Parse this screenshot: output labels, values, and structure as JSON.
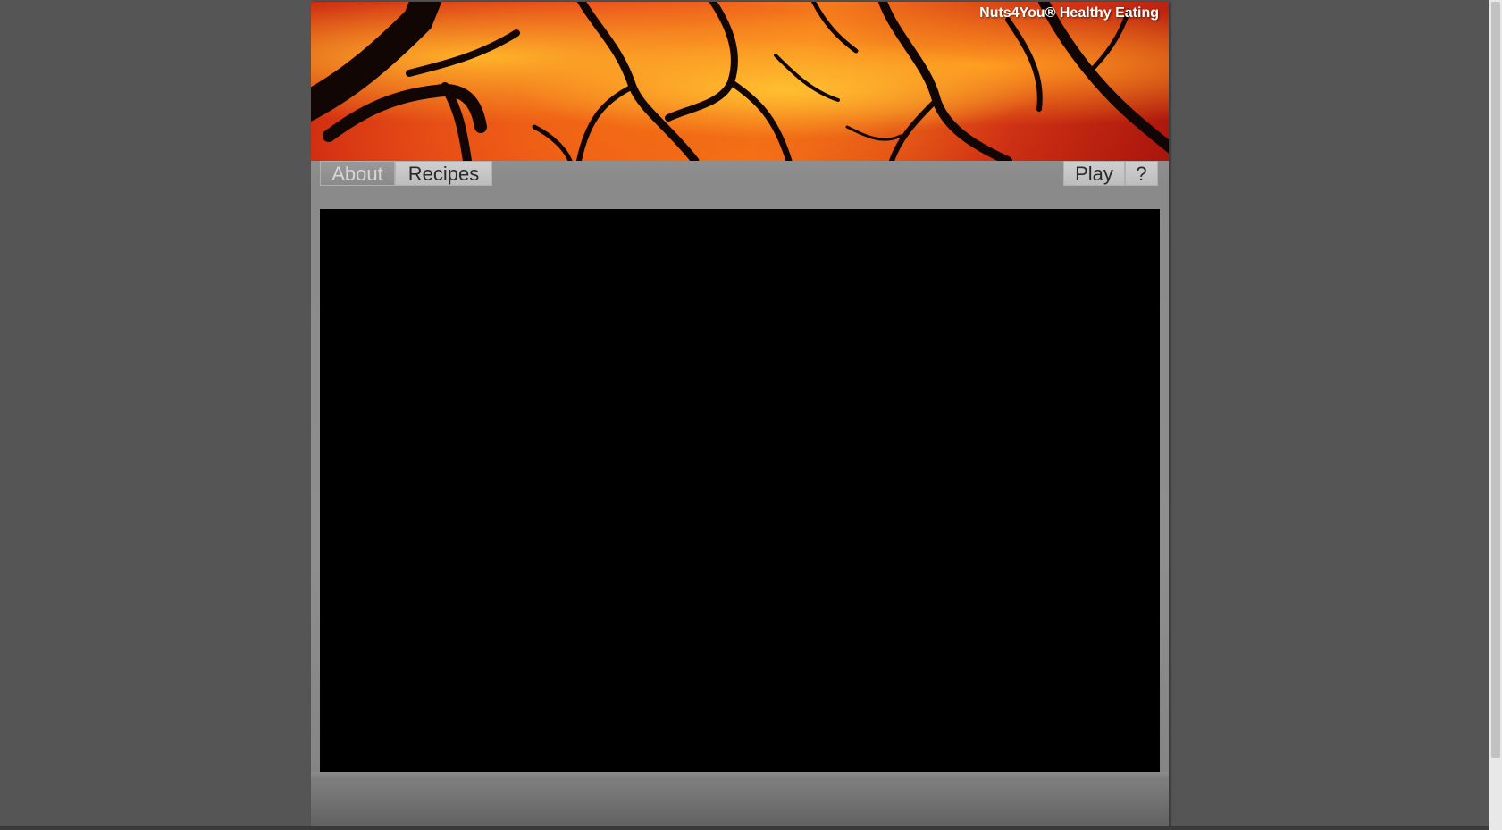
{
  "header": {
    "site_title": "Nuts4You® Healthy Eating"
  },
  "nav": {
    "left": [
      {
        "label": "About",
        "active": true
      },
      {
        "label": "Recipes",
        "active": false
      }
    ],
    "right": [
      {
        "label": "Play"
      },
      {
        "label": "?"
      }
    ]
  },
  "colors": {
    "background": "#555555",
    "content_area": "#000000",
    "title_text": "#ffffff"
  }
}
